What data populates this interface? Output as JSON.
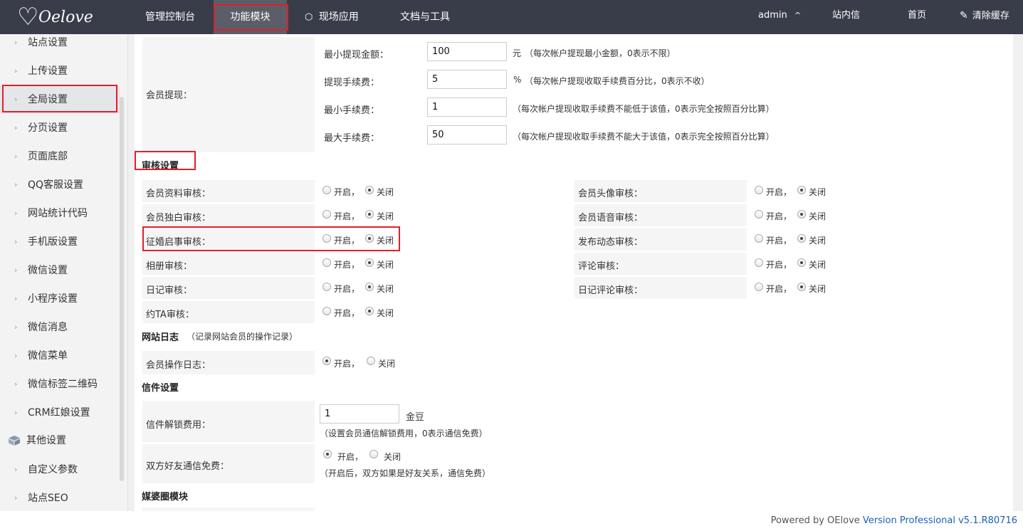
{
  "header": {
    "logo_text": "Oelove",
    "nav": [
      "管理控制台",
      "功能模块",
      "现场应用",
      "文档与工具"
    ],
    "user": "admin",
    "user_caret": "^",
    "links": [
      "站内信",
      "首页",
      "清除缓存"
    ]
  },
  "sidebar": {
    "items": [
      "站点设置",
      "上传设置",
      "全局设置",
      "分页设置",
      "页面底部",
      "QQ客服设置",
      "网站统计代码",
      "手机版设置",
      "微信设置",
      "小程序设置",
      "微信消息",
      "微信菜单",
      "微信标签二维码",
      "CRM红娘设置"
    ],
    "group": "其他设置",
    "group_items": [
      "自定义参数",
      "站点SEO"
    ]
  },
  "withdraw": {
    "label": "会员提现：",
    "fields": [
      {
        "label": "最小提现金额：",
        "value": "100",
        "unit": "元",
        "hint": "（每次帐户提现最小金额，0表示不限）"
      },
      {
        "label": "提现手续费：",
        "value": "5",
        "unit": "%",
        "hint": "（每次帐户提现收取手续费百分比，0表示不收）"
      },
      {
        "label": "最小手续费：",
        "value": "1",
        "unit": "",
        "hint": "（每次帐户提现收取手续费不能低于该值，0表示完全按照百分比算）"
      },
      {
        "label": "最大手续费：",
        "value": "50",
        "unit": "",
        "hint": "（每次帐户提现收取手续费不能大于该值，0表示完全按照百分比算）"
      }
    ]
  },
  "audit": {
    "title": "审核设置",
    "on": "开启，",
    "off": "关闭",
    "left": [
      "会员资料审核：",
      "会员独白审核：",
      "征婚启事审核：",
      "相册审核：",
      "日记审核：",
      "约TA审核："
    ],
    "right": [
      "会员头像审核：",
      "会员语音审核：",
      "发布动态审核：",
      "评论审核：",
      "日记评论审核："
    ]
  },
  "log": {
    "title": "网站日志",
    "note": "（记录网站会员的操作记录）",
    "label": "会员操作日志：",
    "on": "开启，",
    "off": "关闭"
  },
  "letter": {
    "title": "信件设置",
    "unlock_label": "信件解锁费用：",
    "unlock_value": "1",
    "unlock_unit": "金豆",
    "unlock_hint": "（设置会员通信解锁费用，0表示通信免费）",
    "free_label": "双方好友通信免费：",
    "on": "开启，",
    "off": "关闭",
    "free_hint": "（开启后，双方如果是好友关系，通信免费）"
  },
  "next_section": "媒婆圈模块",
  "footer": {
    "prefix": "Powered by OElove ",
    "version": "Version Professional v5.1.R80716"
  }
}
